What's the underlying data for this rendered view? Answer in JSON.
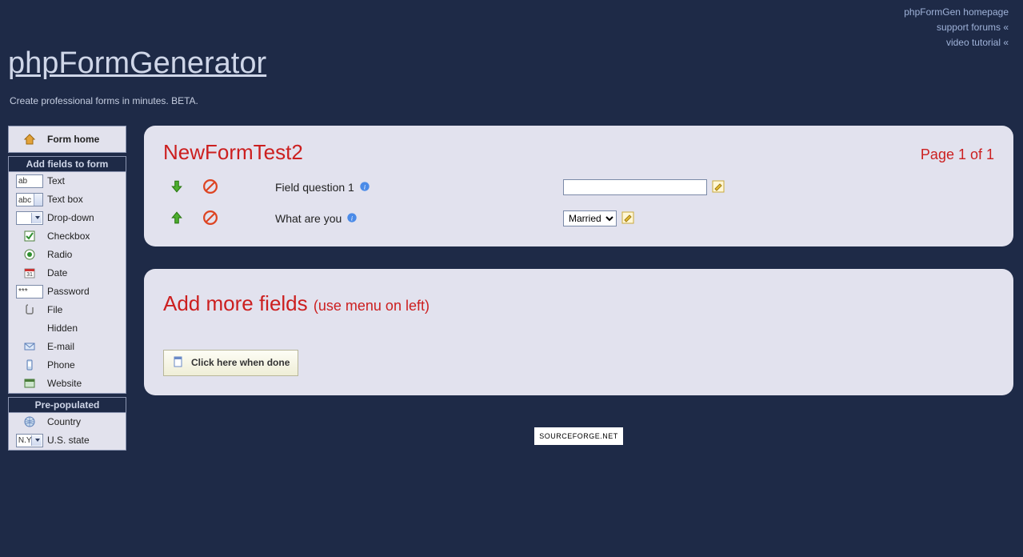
{
  "topnav": {
    "homepage": "phpFormGen homepage",
    "forums": "support forums «",
    "tutorial": "video tutorial «"
  },
  "header": {
    "logo": "phpFormGenerator",
    "tagline": "Create professional forms in minutes. BETA."
  },
  "sidebar": {
    "home": "Form home",
    "section1_title": "Add fields to form",
    "fields": [
      {
        "label": "Text",
        "pill": "ab"
      },
      {
        "label": "Text box",
        "pill": "abc",
        "textbox": true
      },
      {
        "label": "Drop-down",
        "pill": "",
        "select": true
      },
      {
        "label": "Checkbox",
        "icon": "checkbox"
      },
      {
        "label": "Radio",
        "icon": "radio"
      },
      {
        "label": "Date",
        "icon": "date"
      },
      {
        "label": "Password",
        "pill": "***"
      },
      {
        "label": "File",
        "icon": "file"
      },
      {
        "label": "Hidden",
        "icon": ""
      },
      {
        "label": "E-mail",
        "icon": "email"
      },
      {
        "label": "Phone",
        "icon": "phone"
      },
      {
        "label": "Website",
        "icon": "website"
      }
    ],
    "section2_title": "Pre-populated",
    "prepop": [
      {
        "label": "Country",
        "icon": "globe"
      },
      {
        "label": "U.S. state",
        "pill": "N.Y.",
        "select": true
      }
    ]
  },
  "form": {
    "title": "NewFormTest2",
    "page_label": "Page 1 of 1",
    "rows": [
      {
        "question": "Field question 1",
        "type": "text",
        "value": ""
      },
      {
        "question": "What are you",
        "type": "select",
        "value": "Married"
      }
    ],
    "addmore_title": "Add more fields",
    "addmore_sub": "(use menu on left)",
    "done_label": "Click here when done"
  },
  "footer": {
    "sourceforge": "SOURCEFORGE.NET"
  }
}
